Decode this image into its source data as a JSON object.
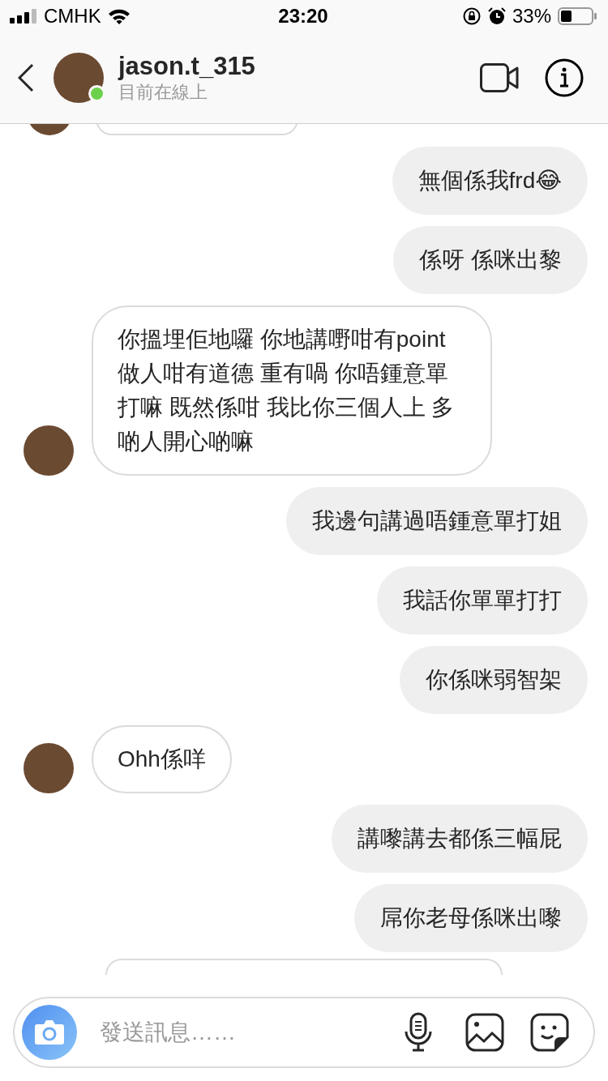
{
  "status_bar": {
    "carrier": "CMHK",
    "time": "23:20",
    "battery": "33%"
  },
  "header": {
    "username": "jason.t_315",
    "status": "目前在線上",
    "online": true
  },
  "messages": [
    {
      "kind": "sent",
      "text": "無個係我frd😂"
    },
    {
      "kind": "sent",
      "text": "係呀 係咪出黎"
    },
    {
      "kind": "received",
      "text": "你搵埋佢地囉 你地講嘢咁有point做人咁有道德 重有喎 你唔鍾意單打嘛 既然係咁 我比你三個人上 多啲人開心啲嘛"
    },
    {
      "kind": "sent",
      "text": "我邊句講過唔鍾意單打姐"
    },
    {
      "kind": "sent",
      "text": "我話你單單打打"
    },
    {
      "kind": "sent",
      "text": "你係咪弱智架"
    },
    {
      "kind": "received",
      "text": "Ohh係咩"
    },
    {
      "kind": "sent",
      "text": "講嚟講去都係三幅屁"
    },
    {
      "kind": "sent",
      "text": "屌你老母係咪出嚟"
    }
  ],
  "composer": {
    "placeholder": "發送訊息……"
  }
}
